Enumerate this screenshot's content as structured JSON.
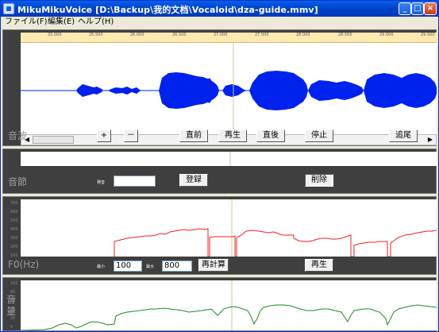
{
  "window": {
    "title": "MikuMikuVoice [D:\\Backup\\我的文档\\Vocaloid\\dza-guide.mmv]",
    "controls": {
      "minimize": "_",
      "maximize": "□",
      "close": "×"
    }
  },
  "menu": [
    "ファイル(F)",
    "編集(E)",
    "ヘルプ(H)"
  ],
  "wave_panel": {
    "label": "音波",
    "ruler_ticks": [
      "25.000",
      "25.500",
      "26.000",
      "26.500",
      "27.000",
      "27.500",
      "28.000",
      "28.500",
      "29.000",
      "29.500"
    ],
    "buttons": [
      "+",
      "－",
      "直前",
      "再生",
      "直後",
      "停止",
      "追尾"
    ]
  },
  "syllable_panel": {
    "label": "音節",
    "phoneme_label": "発音",
    "phoneme_value": "",
    "register_button": "登録",
    "delete_button": "削除"
  },
  "f0_panel": {
    "label": "F0(Hz)",
    "min_label": "最小",
    "min_value": "100",
    "max_label": "最大",
    "max_value": "800",
    "recalc_button": "再計算",
    "play_button": "再生",
    "y_ticks": [
      "700",
      "600",
      "500",
      "400",
      "300",
      "200",
      "100"
    ]
  },
  "volume_panel": {
    "label": "音量",
    "y_ticks": [
      "100",
      "80",
      "60",
      "40",
      "20",
      "0"
    ]
  },
  "colors": {
    "waveform": "#0022ee",
    "f0_line": "#ee2222",
    "volume_line": "#228822",
    "cursor": "#c8c890",
    "panel_bg": "#3f3f3f"
  }
}
